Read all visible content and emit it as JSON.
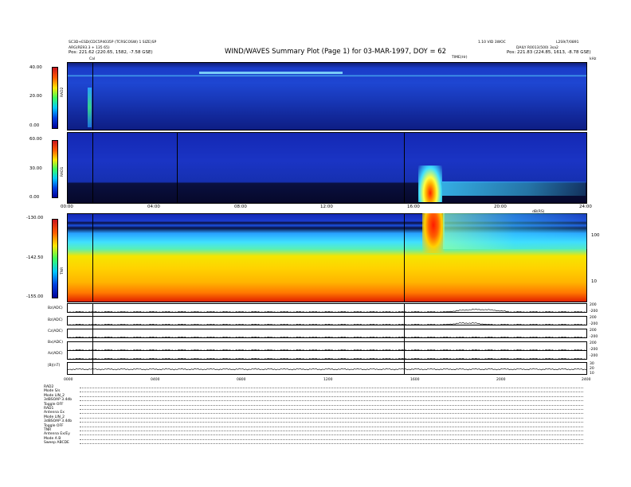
{
  "header": {
    "title": "WIND/WAVES Summary Plot (Page 1) for 03-MAR-1997, DOY = 62",
    "left_line1": "SC3D+ESD(CDC5P4035P (TCRSCOSW) 1 SIZE)SP",
    "left_line2": "ARG(RE93.3 + 135 65)",
    "left_line3": "Pos:   221.62 (220.65, 1582, -7.58 GSE)",
    "cursor_label": "Cal",
    "right_line1": "1.10 VID 3WOC",
    "right_line2": "L2S9/7/0891",
    "right_line3": "DAILY  R0013(500) 3sa2",
    "right_line4": "Pos:   221.83 (224.85, 1613, -8.78 GSE)",
    "time_label": "TIME(Hr)"
  },
  "colors": {
    "background_spec": "#1428b4",
    "low_band": "#0a0a3c",
    "burst": "#ff1a00",
    "tnr_mid": "#f5e600"
  },
  "chart_data": [
    {
      "type": "heatmap",
      "name": "RAD2",
      "ylabel": "RAD2",
      "ylim": [
        0.0,
        40.0
      ],
      "yticks": [
        "40.00",
        "20.00",
        "0.00"
      ]
    },
    {
      "type": "heatmap",
      "name": "RAD1",
      "ylabel": "RAD1",
      "ylim": [
        0.0,
        60.0
      ],
      "yticks": [
        "60.00",
        "30.00",
        "0.00"
      ],
      "xticks": [
        "00:00",
        "04:00",
        "08:00",
        "12:00",
        "16:00",
        "20:00",
        "24:00"
      ],
      "xlim": [
        0,
        24
      ]
    },
    {
      "type": "heatmap",
      "name": "TNR",
      "ylabel": "TNR",
      "ylim": [
        -155.0,
        -130.0
      ],
      "yticks": [
        "-130.00",
        "-142.50",
        "-155.00"
      ],
      "right_axis_label": "dB(RS)",
      "right_ticks": [
        "100",
        "10"
      ]
    },
    {
      "type": "line",
      "traces": [
        {
          "label": "Bz(ADC)",
          "right": [
            "200",
            "0",
            "-200"
          ],
          "hump_start": 17.5,
          "hump_end": 20.5,
          "hump_amp": 0.5
        },
        {
          "label": "Bz(ADC)",
          "right": [
            "200",
            "0",
            "-200"
          ],
          "hump_start": 17.5,
          "hump_end": 19.5,
          "hump_amp": 0.35
        },
        {
          "label": "Cz(ADC)",
          "right": [
            "200",
            "0",
            "-200"
          ],
          "hump_start": 0,
          "hump_end": 0,
          "hump_amp": 0
        },
        {
          "label": "Bx(ADC)",
          "right": [
            "200",
            "0",
            "-200"
          ],
          "hump_start": 0,
          "hump_end": 0,
          "hump_amp": 0
        },
        {
          "label": "Az(ADC)",
          "right": [
            "200",
            "0",
            "-200"
          ],
          "hump_start": 0,
          "hump_end": 0,
          "hump_amp": 0
        },
        {
          "label": "|B|(nT)",
          "right": [
            "30",
            "20",
            "10"
          ],
          "hump_start": 0,
          "hump_end": 0,
          "hump_amp": 0
        }
      ],
      "xticks": [
        "0000",
        "0400",
        "0800",
        "1200",
        "1600",
        "2000",
        "2400"
      ],
      "xlim": [
        0,
        24
      ]
    }
  ],
  "footer_lines": [
    "RAD2",
    "Mode   S/s",
    "Mode   LIN_2",
    "3dBSOAP 3.4db",
    "Toggle   OFF",
    "RAD1",
    "Antenna   Ex",
    "Mode  LIN_2",
    "3dBSOAP 3.4db",
    "Toggle   OFF",
    "TNR",
    "Antenna   Ex/Ey",
    "Mode   A B",
    "Sweep  ABCDE"
  ]
}
